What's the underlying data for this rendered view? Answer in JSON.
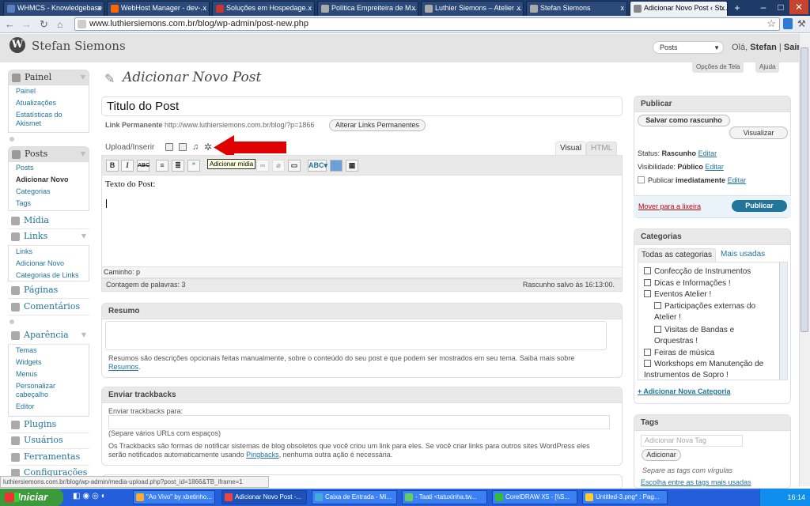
{
  "browser": {
    "tabs": [
      {
        "title": "WHMCS - Knowledgebase",
        "color": "#5a7fbf"
      },
      {
        "title": "WebHost Manager - dev-...",
        "color": "#ff6600"
      },
      {
        "title": "Soluções em Hospedage...",
        "color": "#d33"
      },
      {
        "title": "Política Empreiteira de M...",
        "color": "#888"
      },
      {
        "title": "Luthier Siemons – Atelier ...",
        "color": "#888"
      },
      {
        "title": "Stefan Siemons",
        "color": "#888"
      },
      {
        "title": "Adicionar Novo Post ‹ St...",
        "color": "#888"
      }
    ],
    "url": "www.luthiersiemons.com.br/blog/wp-admin/post-new.php"
  },
  "header": {
    "site_name": "Stefan Siemons",
    "favorites_selected": "Posts",
    "greeting": "Olá,",
    "user": "Stefan",
    "logout": "Sair",
    "screen_options": "Opções de Tela",
    "help": "Ajuda"
  },
  "sidebar": {
    "painel": {
      "label": "Painel",
      "items": [
        "Painel",
        "Atualizações",
        "Estatísticas do",
        "Akismet"
      ]
    },
    "posts": {
      "label": "Posts",
      "items": [
        "Posts",
        "Adicionar Novo",
        "Categorias",
        "Tags"
      ]
    },
    "midia": "Mídia",
    "links": {
      "label": "Links",
      "items": [
        "Links",
        "Adicionar Novo",
        "Categorias de Links"
      ]
    },
    "paginas": "Páginas",
    "comentarios": "Comentários",
    "aparencia": {
      "label": "Aparência",
      "items": [
        "Temas",
        "Widgets",
        "Menus",
        "Personalizar",
        "cabeçalho",
        "Editor"
      ]
    },
    "plugins": "Plugins",
    "usuarios": "Usuários",
    "ferramentas": "Ferramentas",
    "configuracoes": "Configurações"
  },
  "main": {
    "page_title": "Adicionar Novo Post",
    "post_title": "Titulo do Post",
    "permalink_label": "Link Permanente",
    "permalink_url": "http://www.luthiersiemons.com.br/blog/?p=1866",
    "permalink_button": "Alterar Links Permanentes",
    "upload_label": "Upload/Inserir",
    "tab_visual": "Visual",
    "tab_html": "HTML",
    "tooltip": "Adicionar mídia",
    "editor_text": "Texto do Post:",
    "path": "Caminho: p",
    "word_count": "Contagem de palavras: 3",
    "draft_saved": "Rascunho salvo às 16:13:00.",
    "resumo": {
      "title": "Resumo",
      "desc1": "Resumos são descrições opcionais feitas manualmente, sobre o conteúdo do seu post e que podem ser mostrados em seu tema. Saiba mais sobre",
      "desc_link": "Resumos"
    },
    "trackbacks": {
      "title": "Enviar trackbacks",
      "label": "Enviar trackbacks para:",
      "hint": "(Separe vários URLs com espaços)",
      "desc1": "Os Trackbacks são formas de notificar sistemas de blog obsoletos que você criou um link para eles. Se você criar links para outros sites WordPress eles",
      "desc2a": "serão notificados automaticamente usando",
      "desc_link": "Pingbacks",
      "desc2b": ", nenhuma outra ação é necessária."
    }
  },
  "publish": {
    "title": "Publicar",
    "save_draft": "Salvar como rascunho",
    "preview": "Visualizar",
    "status_label": "Status:",
    "status_value": "Rascunho",
    "visibility_label": "Visibilidade:",
    "visibility_value": "Público",
    "publish_label": "Publicar",
    "publish_value": "imediatamente",
    "edit": "Editar",
    "trash": "Mover para a lixeira",
    "publish_button": "Publicar"
  },
  "categories": {
    "title": "Categorias",
    "tab_all": "Todas as categorias",
    "tab_used": "Mais usadas",
    "items": [
      "Confecção de Instrumentos",
      "Dicas e Informações !",
      "Eventos Atelier !",
      "Participações externas do",
      "Atelier !",
      "Visitas de Bandas e",
      "Orquestras !",
      "Feiras de música",
      "Workshops em Manutenção de",
      "Instrumentos de Sopro !"
    ],
    "add_new": "+ Adicionar Nova Categoria"
  },
  "tags": {
    "title": "Tags",
    "placeholder": "Adicionar Nova Tag",
    "button": "Adicionar",
    "hint": "Separe as tags com vírgulas",
    "cloud_link": "Escolha entre as tags mais usadas"
  },
  "statusbar": "luthiersiemons.com.br/blog/wp-admin/media-upload.php?post_id=1866&TB_iframe=1",
  "taskbar": {
    "start": "Iniciar",
    "items": [
      "\"Ao Vivo\" by xbetinho...",
      "Adicionar Novo Post -...",
      "Caixa de Entrada - Mi...",
      "- Taati <tatuxinha.tw...",
      "CorelDRAW X5 - [\\\\S...",
      "Untitled-3.png* : Pag..."
    ],
    "clock": "16:14"
  },
  "colors": {
    "link": "#21759b",
    "publish": "#21759b",
    "arrow": "#e00000",
    "taskbar": "#245edb"
  }
}
